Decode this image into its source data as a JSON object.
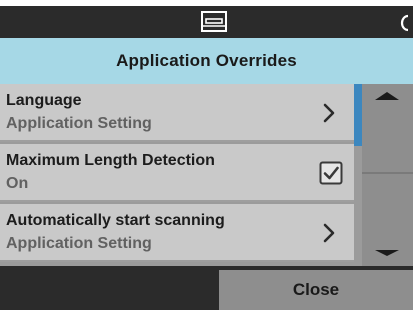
{
  "header": {
    "title": "Application Overrides"
  },
  "status_bar": {
    "icon": "scanner-icon",
    "partial_icon": "clipped-icon"
  },
  "settings": [
    {
      "label": "Language",
      "value": "Application Setting",
      "control": "chevron-right-icon"
    },
    {
      "label": "Maximum Length Detection",
      "value": "On",
      "control": "checkbox",
      "checked": true
    },
    {
      "label": "Automatically start scanning",
      "value": "Application Setting",
      "control": "chevron-right-icon"
    }
  ],
  "scroll": {
    "up_icon": "arrow-up-icon",
    "down_icon": "arrow-down-icon",
    "thumb_position": 0
  },
  "footer": {
    "close_label": "Close"
  },
  "colors": {
    "header_bg": "#a6d8e6",
    "accent": "#3c87bf",
    "row_bg": "#c9c9c9",
    "button_bg": "#8e8e8e",
    "chrome_bg": "#2b2b2b"
  }
}
